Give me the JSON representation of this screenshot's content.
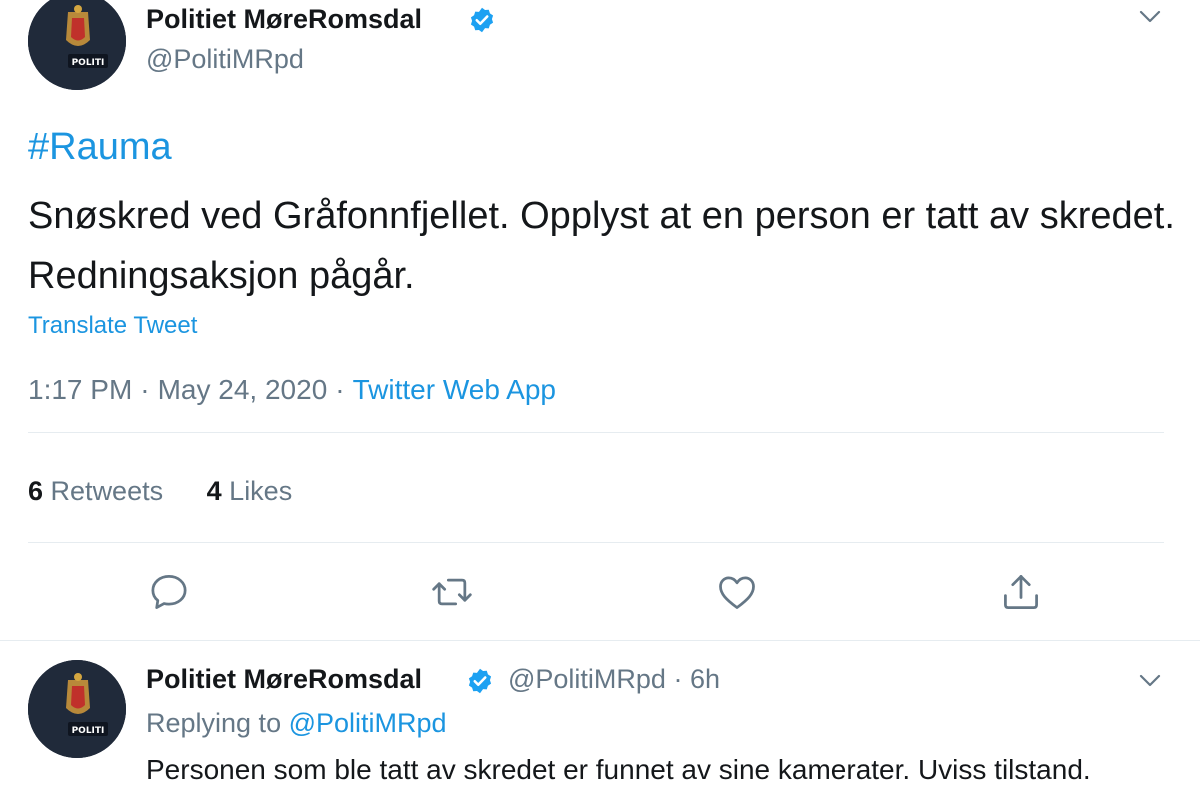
{
  "tweet": {
    "author_name": "Politiet MøreRomsdal",
    "author_handle": "@PolitiMRpd",
    "avatar_label": "POLITI",
    "hashtag": "#Rauma",
    "text": "Snøskred ved Gråfonnfjellet. Opplyst at en person er tatt av skredet. Redningsaksjon pågår.",
    "translate_label": "Translate Tweet",
    "time": "1:17 PM",
    "date": "May 24, 2020",
    "source": "Twitter Web App",
    "separator": "·",
    "retweets_count": "6",
    "retweets_label": "Retweets",
    "likes_count": "4",
    "likes_label": "Likes",
    "actions": [
      "reply-icon",
      "retweet-icon",
      "like-icon",
      "share-icon"
    ]
  },
  "reply": {
    "author_name": "Politiet MøreRomsdal",
    "author_handle": "@PolitiMRpd",
    "separator": "·",
    "age": "6h",
    "avatar_label": "POLITI",
    "replying_to_label": "Replying to",
    "replying_to_handle": "@PolitiMRpd",
    "text": "Personen som ble tatt av skredet er funnet av sine kamerater. Uviss tilstand."
  },
  "colors": {
    "link_blue": "#1b95e0",
    "secondary_text": "#657786",
    "primary_text": "#14171a",
    "divider": "#e6ecf0",
    "verified_blue": "#1da1f2"
  }
}
